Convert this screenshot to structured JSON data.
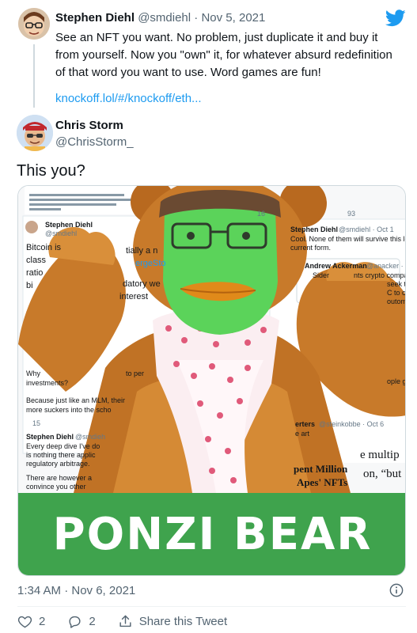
{
  "quoted_tweet": {
    "name": "Stephen Diehl",
    "handle": "@smdiehl",
    "separator": "·",
    "date": "Nov 5, 2021",
    "text": "See an NFT you want. No problem, just duplicate it and buy it from yourself. Now you \"own\" it, for whatever absurd redefinition of that word you want to use. Word games are fun!",
    "link": "knockoff.lol/#/knockoff/eth..."
  },
  "tweet": {
    "name": "Chris Storm",
    "handle": "@ChrisStorm_",
    "text": "This you?",
    "timestamp": "1:34 AM · Nov 6, 2021"
  },
  "media": {
    "banner_text": "PONZI BEAR",
    "bg_fragments": {
      "left_name": "Stephen Diehl",
      "left_handle": "@smdiehl",
      "bitcoin": "Bitcoin is",
      "class": "class",
      "ratio": "ratio",
      "bi": "bi",
      "tially": "tially a n",
      "erge": "ergeSto",
      "datory": "datory we",
      "interest": "interest",
      "why": "Why",
      "to_per": "to per",
      "investments": "investments?",
      "mlm1": "Because just like an MLM, their",
      "mlm2": "more suckers into the scho",
      "reply_count": "15",
      "lower_name": "Stephen Diehl",
      "lower_handle": "@smdieh",
      "lower1": "Every deep dive I've do",
      "lower2": "is nothing there applic",
      "lower3": "regulatory arbitrage.",
      "lower4": "There are however a",
      "lower5": "convince you other",
      "right_name": "Stephen Diehl",
      "right_handle": "@smdiehl · Oct 1",
      "right1": "Cool. None of them will survive this level of",
      "right2": "current form.",
      "right3": "Andrew Ackerman",
      "right4": "@anacker · Oc",
      "right5": "Sider",
      "right6": "nts crypto companie",
      "right7": "seek t",
      "right8": "C to c",
      "right9": "outom",
      "erters": "erters",
      "steinkobbe": "@steinkobbe · Oct 6",
      "art": "e art",
      "ople": "ople ga",
      "multip": "e multip",
      "million": "pent Million",
      "on_but": "on, “but",
      "apes": "Apes' NFTs",
      "top_count1": "16",
      "top_count2": "93"
    }
  },
  "actions": {
    "likes": "2",
    "replies": "2",
    "share": "Share this Tweet"
  },
  "colors": {
    "link": "#1d9bf0",
    "banner": "#3fa34d",
    "fur": "#c87a2a",
    "face": "#5bd35a"
  }
}
